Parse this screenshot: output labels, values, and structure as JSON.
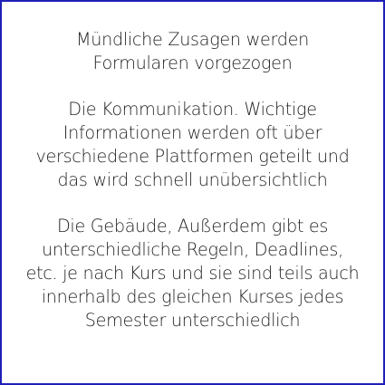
{
  "colors": {
    "border": "#1f1fb8",
    "text": "#222222",
    "background": "#ffffff"
  },
  "note": {
    "paragraphs": [
      {
        "lines": [
          "Mündliche Zusagen werden",
          "Formularen vorgezogen"
        ]
      },
      {
        "lines": [
          "Die Kommunikation. Wichtige",
          "Informationen werden oft über",
          "verschiedene Plattformen geteilt und",
          "das wird schnell unübersichtlich"
        ]
      },
      {
        "lines": [
          "Die Gebäude, Außerdem gibt es",
          "unterschiedliche Regeln, Deadlines,",
          "etc. je nach Kurs und sie sind teils auch",
          "innerhalb des gleichen Kurses jedes",
          "Semester unterschiedlich"
        ]
      }
    ]
  }
}
